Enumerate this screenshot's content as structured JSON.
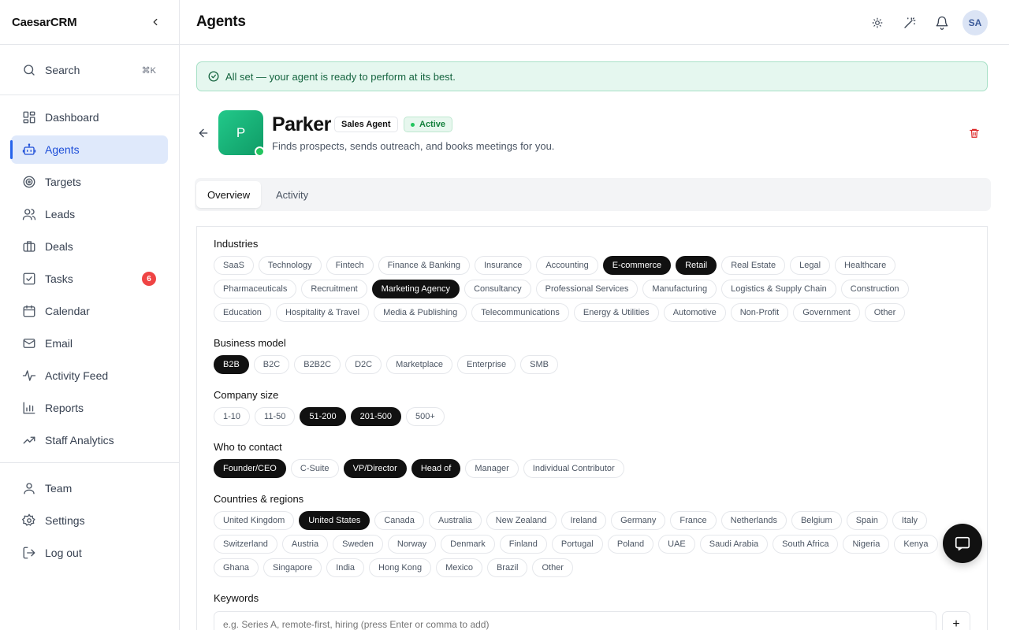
{
  "brand": "CaesarCRM",
  "sidebar": {
    "search": {
      "label": "Search",
      "shortcut": "⌘K"
    },
    "items": [
      {
        "label": "Dashboard"
      },
      {
        "label": "Agents"
      },
      {
        "label": "Targets"
      },
      {
        "label": "Leads"
      },
      {
        "label": "Deals"
      },
      {
        "label": "Tasks",
        "badge": "6"
      },
      {
        "label": "Calendar"
      },
      {
        "label": "Email"
      },
      {
        "label": "Activity Feed"
      },
      {
        "label": "Reports"
      },
      {
        "label": "Staff Analytics"
      }
    ],
    "bottom": [
      {
        "label": "Team"
      },
      {
        "label": "Settings"
      },
      {
        "label": "Log out"
      }
    ]
  },
  "header": {
    "title": "Agents",
    "avatar": "SA"
  },
  "banner": {
    "text": "All set — your agent is ready to perform at its best."
  },
  "agent": {
    "initial": "P",
    "name": "Parker",
    "role": "Sales Agent",
    "status": "Active",
    "description": "Finds prospects, sends outreach, and books meetings for you."
  },
  "tabs": [
    {
      "label": "Overview"
    },
    {
      "label": "Activity"
    }
  ],
  "sections": {
    "industries": {
      "label": "Industries",
      "rows": [
        [
          {
            "t": "SaaS",
            "s": false
          },
          {
            "t": "Technology",
            "s": false
          },
          {
            "t": "Fintech",
            "s": false
          },
          {
            "t": "Finance & Banking",
            "s": false
          },
          {
            "t": "Insurance",
            "s": false
          },
          {
            "t": "Accounting",
            "s": false
          },
          {
            "t": "E-commerce",
            "s": true
          },
          {
            "t": "Retail",
            "s": true
          },
          {
            "t": "Real Estate",
            "s": false
          },
          {
            "t": "Legal",
            "s": false
          },
          {
            "t": "Healthcare",
            "s": false
          }
        ],
        [
          {
            "t": "Pharmaceuticals",
            "s": false
          },
          {
            "t": "Recruitment",
            "s": false
          },
          {
            "t": "Marketing Agency",
            "s": true
          },
          {
            "t": "Consultancy",
            "s": false
          },
          {
            "t": "Professional Services",
            "s": false
          },
          {
            "t": "Manufacturing",
            "s": false
          },
          {
            "t": "Logistics & Supply Chain",
            "s": false
          },
          {
            "t": "Construction",
            "s": false
          }
        ],
        [
          {
            "t": "Education",
            "s": false
          },
          {
            "t": "Hospitality & Travel",
            "s": false
          },
          {
            "t": "Media & Publishing",
            "s": false
          },
          {
            "t": "Telecommunications",
            "s": false
          },
          {
            "t": "Energy & Utilities",
            "s": false
          },
          {
            "t": "Automotive",
            "s": false
          },
          {
            "t": "Non-Profit",
            "s": false
          },
          {
            "t": "Government",
            "s": false
          },
          {
            "t": "Other",
            "s": false
          }
        ]
      ]
    },
    "business_model": {
      "label": "Business model",
      "rows": [
        [
          {
            "t": "B2B",
            "s": true
          },
          {
            "t": "B2C",
            "s": false
          },
          {
            "t": "B2B2C",
            "s": false
          },
          {
            "t": "D2C",
            "s": false
          },
          {
            "t": "Marketplace",
            "s": false
          },
          {
            "t": "Enterprise",
            "s": false
          },
          {
            "t": "SMB",
            "s": false
          }
        ]
      ]
    },
    "company_size": {
      "label": "Company size",
      "rows": [
        [
          {
            "t": "1-10",
            "s": false
          },
          {
            "t": "11-50",
            "s": false
          },
          {
            "t": "51-200",
            "s": true
          },
          {
            "t": "201-500",
            "s": true
          },
          {
            "t": "500+",
            "s": false
          }
        ]
      ]
    },
    "who_to_contact": {
      "label": "Who to contact",
      "rows": [
        [
          {
            "t": "Founder/CEO",
            "s": true
          },
          {
            "t": "C-Suite",
            "s": false
          },
          {
            "t": "VP/Director",
            "s": true
          },
          {
            "t": "Head of",
            "s": true
          },
          {
            "t": "Manager",
            "s": false
          },
          {
            "t": "Individual Contributor",
            "s": false
          }
        ]
      ]
    },
    "countries": {
      "label": "Countries & regions",
      "rows": [
        [
          {
            "t": "United Kingdom",
            "s": false
          },
          {
            "t": "United States",
            "s": true
          },
          {
            "t": "Canada",
            "s": false
          },
          {
            "t": "Australia",
            "s": false
          },
          {
            "t": "New Zealand",
            "s": false
          },
          {
            "t": "Ireland",
            "s": false
          },
          {
            "t": "Germany",
            "s": false
          },
          {
            "t": "France",
            "s": false
          },
          {
            "t": "Netherlands",
            "s": false
          },
          {
            "t": "Belgium",
            "s": false
          },
          {
            "t": "Spain",
            "s": false
          },
          {
            "t": "Italy",
            "s": false
          }
        ],
        [
          {
            "t": "Switzerland",
            "s": false
          },
          {
            "t": "Austria",
            "s": false
          },
          {
            "t": "Sweden",
            "s": false
          },
          {
            "t": "Norway",
            "s": false
          },
          {
            "t": "Denmark",
            "s": false
          },
          {
            "t": "Finland",
            "s": false
          },
          {
            "t": "Portugal",
            "s": false
          },
          {
            "t": "Poland",
            "s": false
          },
          {
            "t": "UAE",
            "s": false
          },
          {
            "t": "Saudi Arabia",
            "s": false
          },
          {
            "t": "South Africa",
            "s": false
          },
          {
            "t": "Nigeria",
            "s": false
          },
          {
            "t": "Kenya",
            "s": false
          }
        ],
        [
          {
            "t": "Ghana",
            "s": false
          },
          {
            "t": "Singapore",
            "s": false
          },
          {
            "t": "India",
            "s": false
          },
          {
            "t": "Hong Kong",
            "s": false
          },
          {
            "t": "Mexico",
            "s": false
          },
          {
            "t": "Brazil",
            "s": false
          },
          {
            "t": "Other",
            "s": false
          }
        ]
      ]
    },
    "keywords": {
      "label": "Keywords",
      "placeholder": "e.g. Series A, remote-first, hiring (press Enter or comma to add)",
      "add_label": "+"
    }
  }
}
